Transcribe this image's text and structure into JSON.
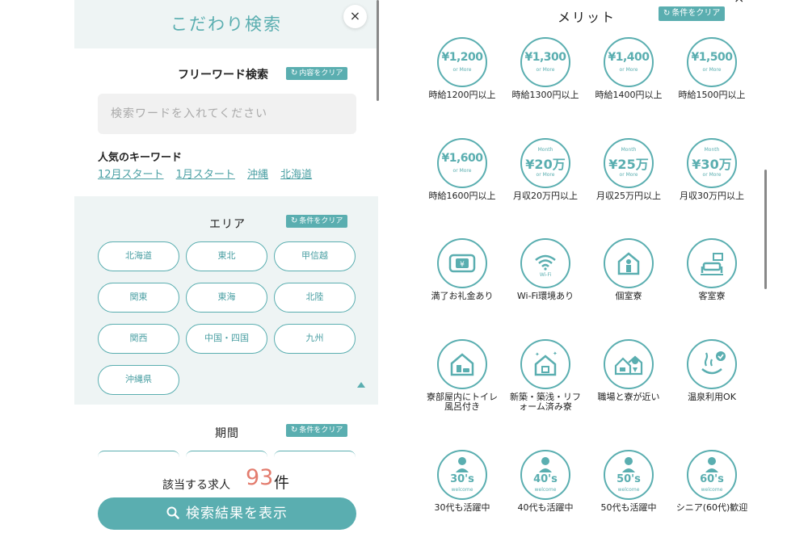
{
  "left": {
    "title": "こだわり検索",
    "close": "×",
    "freeword": {
      "title": "フリーワード検索",
      "clear": "内容をクリア",
      "placeholder": "検索ワードを入れてください"
    },
    "popular": {
      "title": "人気のキーワード",
      "keywords": [
        "12月スタート",
        "1月スタート",
        "沖縄",
        "北海道"
      ]
    },
    "area": {
      "title": "エリア",
      "clear": "条件をクリア",
      "items": [
        "北海道",
        "東北",
        "甲信越",
        "関東",
        "東海",
        "北陸",
        "関西",
        "中国・四国",
        "九州",
        "沖縄県"
      ]
    },
    "period": {
      "title": "期間",
      "clear": "条件をクリア"
    },
    "result": {
      "label": "該当する求人",
      "count": "93",
      "unit": "件"
    },
    "submit": "検索結果を表示"
  },
  "right": {
    "title": "メリット",
    "clear": "条件をクリア",
    "close": "×",
    "items": [
      {
        "kind": "wage",
        "amount": "¥1,200",
        "sub": "or More",
        "label": "時給1200円以上"
      },
      {
        "kind": "wage",
        "amount": "¥1,300",
        "sub": "or More",
        "label": "時給1300円以上"
      },
      {
        "kind": "wage",
        "amount": "¥1,400",
        "sub": "or More",
        "label": "時給1400円以上"
      },
      {
        "kind": "wage",
        "amount": "¥1,500",
        "sub": "or More",
        "label": "時給1500円以上"
      },
      {
        "kind": "wage",
        "amount": "¥1,600",
        "sub": "or More",
        "label": "時給1600円以上"
      },
      {
        "kind": "month",
        "top": "Month",
        "amount": "¥20万",
        "sub": "or More",
        "label": "月収20万円以上"
      },
      {
        "kind": "month",
        "top": "Month",
        "amount": "¥25万",
        "sub": "or More",
        "label": "月収25万円以上"
      },
      {
        "kind": "month",
        "top": "Month",
        "amount": "¥30万",
        "sub": "or More",
        "label": "月収30万円以上"
      },
      {
        "kind": "icon",
        "icon": "money-icon",
        "label": "満了お礼金あり"
      },
      {
        "kind": "icon",
        "icon": "wifi-icon",
        "text": "Wi-Fi",
        "label": "Wi-Fi環境あり"
      },
      {
        "kind": "icon",
        "icon": "private-room-icon",
        "label": "個室寮"
      },
      {
        "kind": "icon",
        "icon": "guest-room-icon",
        "label": "客室寮"
      },
      {
        "kind": "icon",
        "icon": "bath-toilet-icon",
        "label": "寮部屋内にトイレ風呂付き"
      },
      {
        "kind": "icon",
        "icon": "new-house-icon",
        "label": "新築・築浅・リフォーム済み寮"
      },
      {
        "kind": "icon",
        "icon": "near-workplace-icon",
        "label": "職場と寮が近い"
      },
      {
        "kind": "icon",
        "icon": "hot-spring-icon",
        "label": "温泉利用OK"
      },
      {
        "kind": "age",
        "amount": "30's",
        "sub": "welcome",
        "label": "30代も活躍中"
      },
      {
        "kind": "age",
        "amount": "40's",
        "sub": "welcome",
        "label": "40代も活躍中"
      },
      {
        "kind": "age",
        "amount": "50's",
        "sub": "welcome",
        "label": "50代も活躍中"
      },
      {
        "kind": "age",
        "amount": "60's",
        "sub": "welcome",
        "label": "シニア(60代)歓迎"
      }
    ]
  },
  "colors": {
    "accent": "#5aaeb0",
    "count": "#e37c6e",
    "panel_bg": "#eef4f4"
  }
}
